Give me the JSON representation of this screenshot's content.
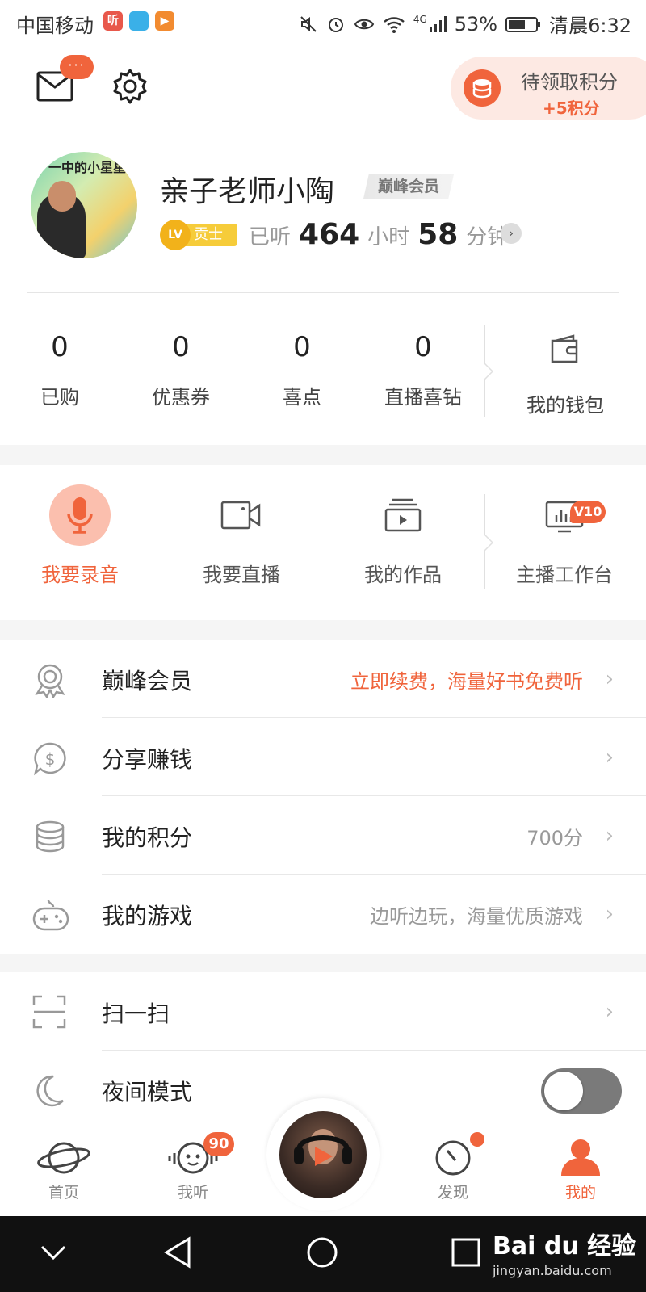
{
  "status_bar": {
    "carrier": "中国移动",
    "app_icons": [
      "听",
      "",
      "▶"
    ],
    "network": "4G",
    "battery": "53%",
    "time": "清晨6:32"
  },
  "header": {
    "mail_badge": "···",
    "points_title": "待领取积分",
    "points_sub": "+5积分"
  },
  "profile": {
    "avatar_text": "一中的小星星",
    "username": "亲子老师小陶",
    "vip_tag": "巅峰会员",
    "level_badge": "LV",
    "level_title": "贡士",
    "listen_prefix": "已听",
    "hours": "464",
    "hours_unit": "小时",
    "minutes": "58",
    "minutes_unit": "分钟"
  },
  "stats": [
    {
      "value": "0",
      "label": "已购"
    },
    {
      "value": "0",
      "label": "优惠券"
    },
    {
      "value": "0",
      "label": "喜点"
    },
    {
      "value": "0",
      "label": "直播喜钻"
    }
  ],
  "wallet": {
    "label": "我的钱包"
  },
  "creator": {
    "record": "我要录音",
    "live": "我要直播",
    "works": "我的作品",
    "studio": "主播工作台",
    "studio_badge": "V10"
  },
  "menu": [
    {
      "title": "巅峰会员",
      "right": "立即续费，海量好书免费听",
      "icon": "medal-icon"
    },
    {
      "title": "分享赚钱",
      "right": "",
      "icon": "dollar-chat-icon"
    },
    {
      "title": "我的积分",
      "right": "700分",
      "icon": "coins-stack-icon"
    },
    {
      "title": "我的游戏",
      "right": "边听边玩，海量优质游戏",
      "icon": "gamepad-icon"
    }
  ],
  "menu2": [
    {
      "title": "扫一扫",
      "icon": "scan-icon"
    },
    {
      "title": "夜间模式",
      "icon": "moon-icon"
    }
  ],
  "tabs": {
    "home": "首页",
    "listen": "我听",
    "listen_badge": "90",
    "discover": "发现",
    "mine": "我的"
  },
  "watermark": {
    "main": "Bai du 经验",
    "sub": "jingyan.baidu.com"
  },
  "colors": {
    "accent": "#f0643c",
    "vip_gold": "#f2b21a"
  }
}
